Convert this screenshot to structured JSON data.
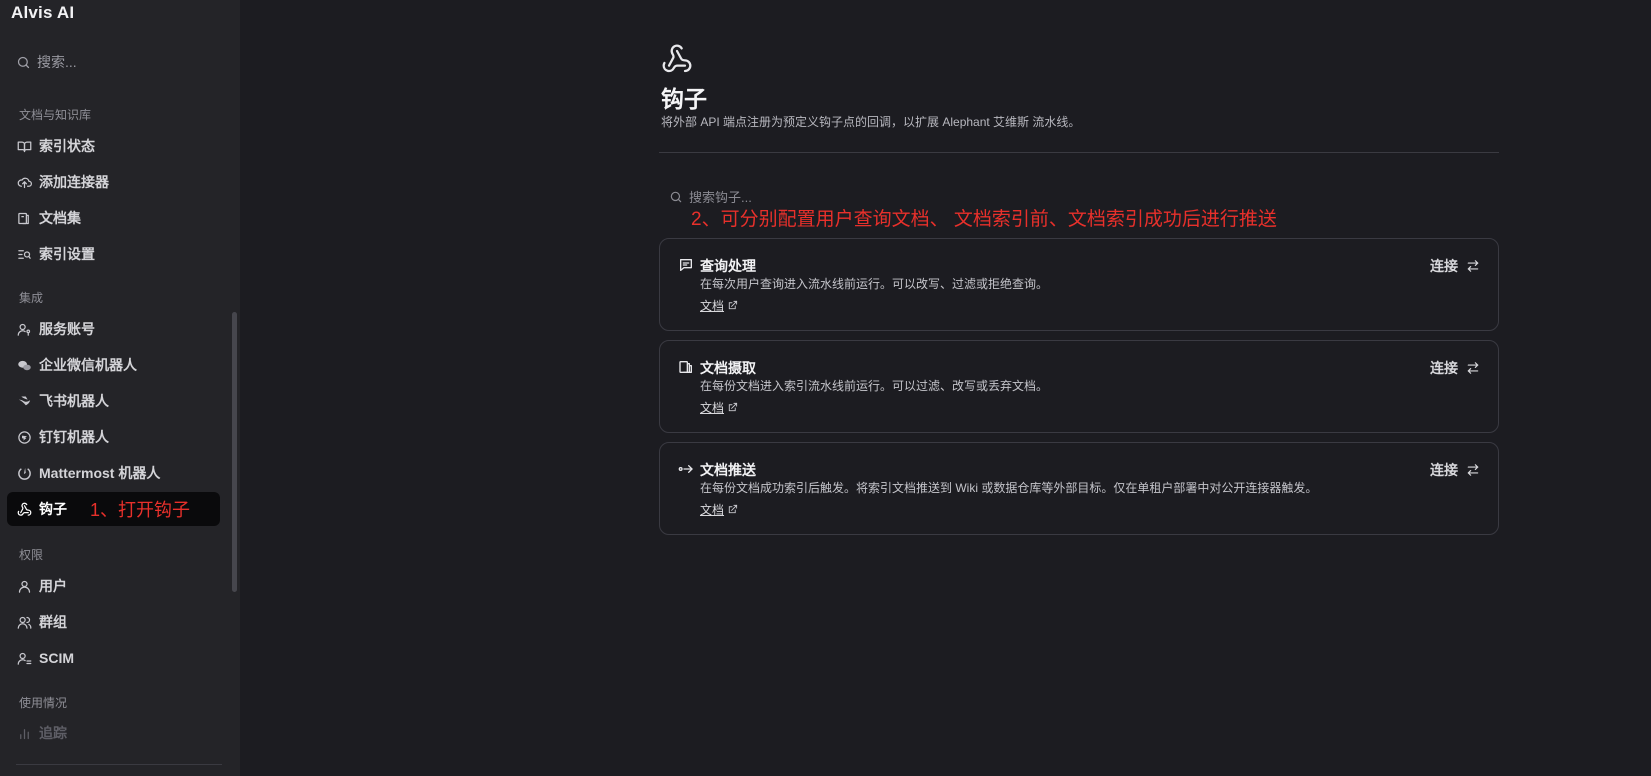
{
  "app": {
    "title": "Alvis AI"
  },
  "sidebar": {
    "search_placeholder": "搜索...",
    "sections": {
      "docs": "文档与知识库",
      "integrations": "集成",
      "permissions": "权限",
      "usage": "使用情况"
    },
    "items": [
      {
        "label": "索引状态",
        "icon": "book-open-icon"
      },
      {
        "label": "添加连接器",
        "icon": "cloud-upload-icon"
      },
      {
        "label": "文档集",
        "icon": "documents-icon"
      },
      {
        "label": "索引设置",
        "icon": "list-search-icon"
      },
      {
        "label": "服务账号",
        "icon": "user-key-icon"
      },
      {
        "label": "企业微信机器人",
        "icon": "wechat-icon"
      },
      {
        "label": "飞书机器人",
        "icon": "feishu-icon"
      },
      {
        "label": "钉钉机器人",
        "icon": "dingtalk-icon"
      },
      {
        "label": "Mattermost 机器人",
        "icon": "mattermost-icon"
      },
      {
        "label": "钩子",
        "icon": "webhook-icon",
        "active": true,
        "annotation": "1、打开钩子"
      },
      {
        "label": "用户",
        "icon": "user-icon"
      },
      {
        "label": "群组",
        "icon": "users-icon"
      },
      {
        "label": "SCIM",
        "icon": "user-sync-icon"
      },
      {
        "label": "追踪",
        "icon": "bar-chart-icon"
      }
    ]
  },
  "main": {
    "title": "钩子",
    "description": "将外部 API 端点注册为预定义钩子点的回调，以扩展 Alephant 艾维斯 流水线。",
    "search_placeholder": "搜索钩子...",
    "annotation": "2、可分别配置用户查询文档、 文档索引前、文档索引成功后进行推送",
    "hooks": [
      {
        "title": "查询处理",
        "icon": "message-square-icon",
        "description": "在每次用户查询进入流水线前运行。可以改写、过滤或拒绝查询。",
        "doc_label": "文档",
        "connect_label": "连接"
      },
      {
        "title": "文档摄取",
        "icon": "documents-icon",
        "description": "在每份文档进入索引流水线前运行。可以过滤、改写或丢弃文档。",
        "doc_label": "文档",
        "connect_label": "连接"
      },
      {
        "title": "文档推送",
        "icon": "push-arrow-icon",
        "description": "在每份文档成功索引后触发。将索引文档推送到 Wiki 或数据仓库等外部目标。仅在单租户部署中对公开连接器触发。",
        "doc_label": "文档",
        "connect_label": "连接"
      }
    ]
  }
}
